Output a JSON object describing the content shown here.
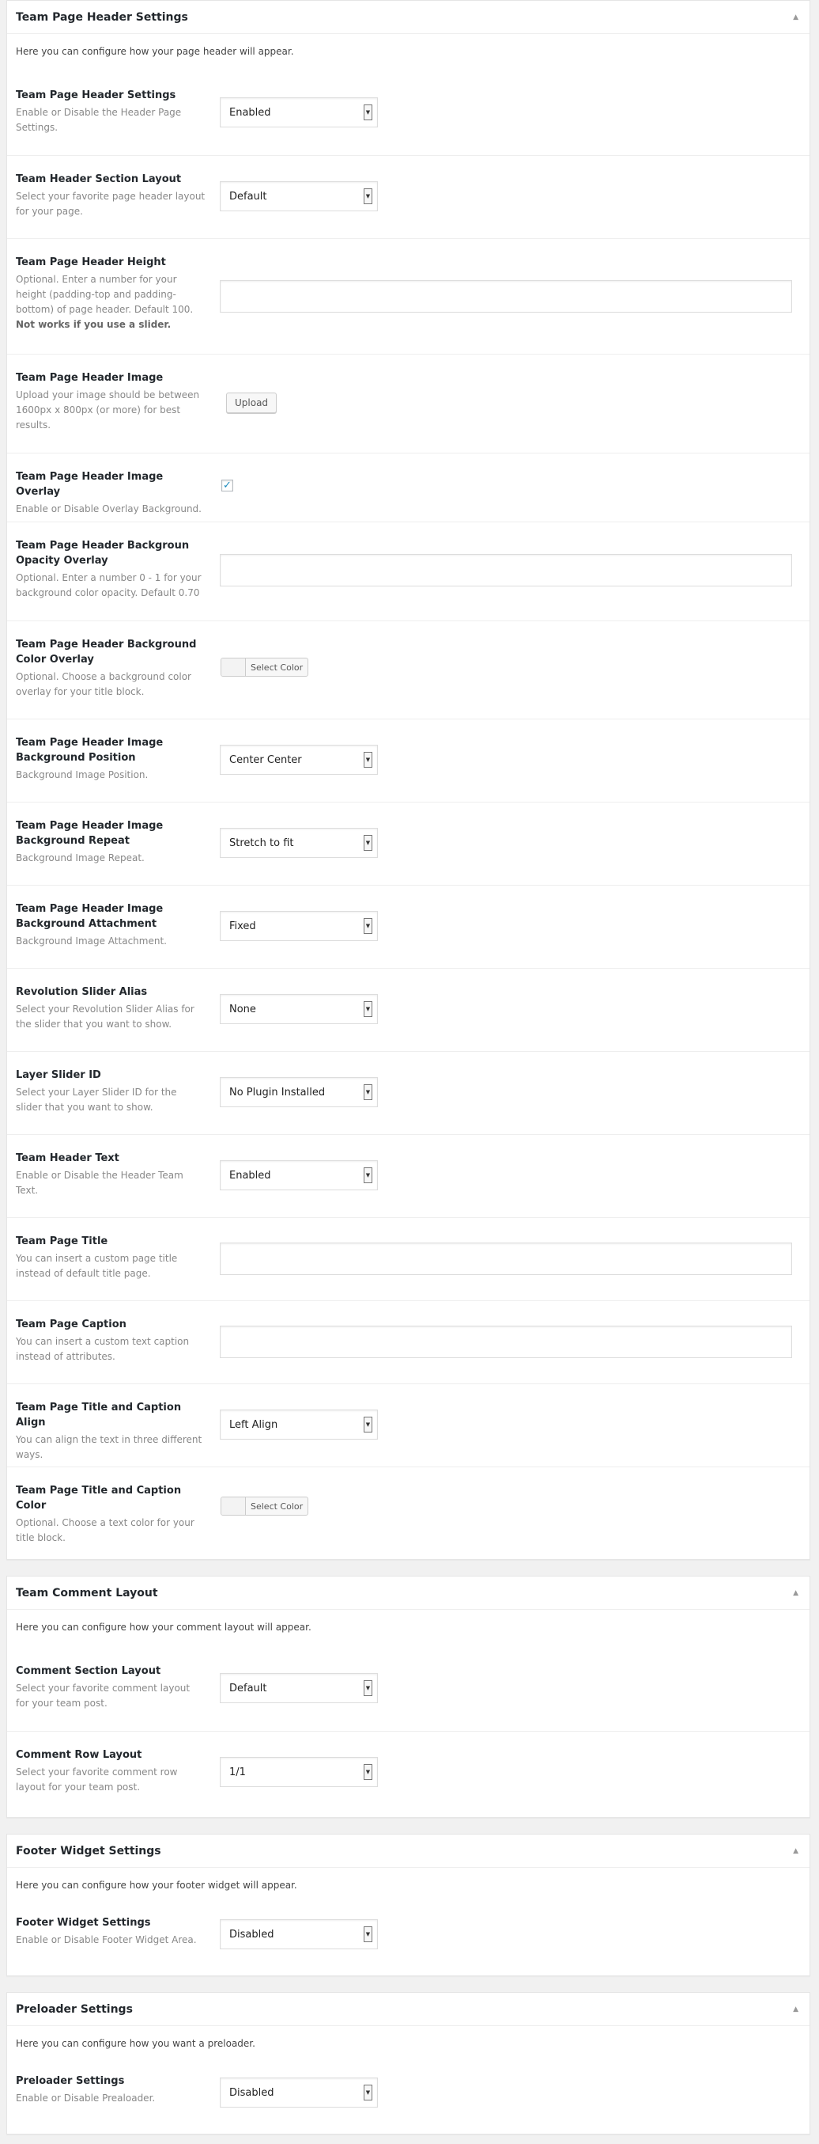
{
  "panels": [
    {
      "title": "Team Page Header Settings",
      "intro": "Here you can configure how your page header will appear.",
      "fields": [
        {
          "label": "Team Page Header Settings",
          "desc": "Enable or Disable the Header Page Settings.",
          "value": "Enabled"
        },
        {
          "label": "Team Header Section Layout",
          "desc": "Select your favorite page header layout for your page.",
          "value": "Default"
        },
        {
          "label": "Team Page Header Height",
          "desc": "Optional. Enter a number for your height (padding-top and padding-bottom) of page header. Default 100.",
          "desc_strong": "Not works if you use a slider.",
          "value": ""
        },
        {
          "label": "Team Page Header Image",
          "desc": "Upload your image should be between 1600px x 800px (or more) for best results.",
          "button": "Upload"
        },
        {
          "label": "Team Page Header Image Overlay",
          "desc": "Enable or Disable Overlay Background.",
          "checked": true
        },
        {
          "label": "Team Page Header Backgroun Opacity Overlay",
          "desc": "Optional. Enter a number 0 - 1 for your background color opacity. Default 0.70",
          "value": ""
        },
        {
          "label": "Team Page Header Background Color Overlay",
          "desc": "Optional. Choose a background color overlay for your title block.",
          "button": "Select Color"
        },
        {
          "label": "Team Page Header Image Background Position",
          "desc": "Background Image Position.",
          "value": "Center Center"
        },
        {
          "label": "Team Page Header Image Background Repeat",
          "desc": "Background Image Repeat.",
          "value": "Stretch to fit"
        },
        {
          "label": "Team Page Header Image Background Attachment",
          "desc": "Background Image Attachment.",
          "value": "Fixed"
        },
        {
          "label": "Revolution Slider Alias",
          "desc": "Select your Revolution Slider Alias for the slider that you want to show.",
          "value": "None"
        },
        {
          "label": "Layer Slider ID",
          "desc": "Select your Layer Slider ID for the slider that you want to show.",
          "value": "No Plugin Installed"
        },
        {
          "label": "Team Header Text",
          "desc": "Enable or Disable the Header Team Text.",
          "value": "Enabled"
        },
        {
          "label": "Team Page Title",
          "desc": "You can insert a custom page title instead of default title page.",
          "value": ""
        },
        {
          "label": "Team Page Caption",
          "desc": "You can insert a custom text caption instead of attributes.",
          "value": ""
        },
        {
          "label": "Team Page Title and Caption Align",
          "desc": "You can align the text in three different ways.",
          "value": "Left Align"
        },
        {
          "label": "Team Page Title and Caption Color",
          "desc": "Optional. Choose a text color for your title block.",
          "button": "Select Color"
        }
      ]
    },
    {
      "title": "Team Comment Layout",
      "intro": "Here you can configure how your comment layout will appear.",
      "fields": [
        {
          "label": "Comment Section Layout",
          "desc": "Select your favorite comment layout for your team post.",
          "value": "Default"
        },
        {
          "label": "Comment Row Layout",
          "desc": "Select your favorite comment row layout for your team post.",
          "value": "1/1"
        }
      ]
    },
    {
      "title": "Footer Widget Settings",
      "intro": "Here you can configure how your footer widget will appear.",
      "fields": [
        {
          "label": "Footer Widget Settings",
          "desc": "Enable or Disable Footer Widget Area.",
          "value": "Disabled"
        }
      ]
    },
    {
      "title": "Preloader Settings",
      "intro": "Here you can configure how you want a preloader.",
      "fields": [
        {
          "label": "Preloader Settings",
          "desc": "Enable or Disable Prealoader.",
          "value": "Disabled"
        }
      ]
    }
  ],
  "icons": {
    "toggle": "triangle-up-icon",
    "dropdown": "dropdown-arrow-icon",
    "check": "checkmark-icon"
  }
}
